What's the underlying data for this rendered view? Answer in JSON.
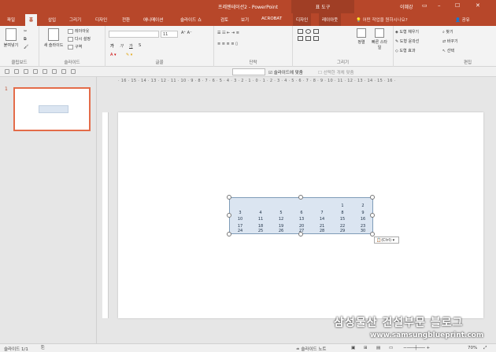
{
  "titlebar": {
    "title": "프레젠테이션2 - PowerPoint",
    "context": "표 도구",
    "user": "이혜강"
  },
  "tabs": [
    "파일",
    "홈",
    "삽입",
    "그리기",
    "디자인",
    "전환",
    "애니메이션",
    "슬라이드 쇼",
    "검토",
    "보기",
    "ACROBAT",
    "디자인",
    "레이아웃"
  ],
  "tellme": "어떤 작업을 원하시나요?",
  "share": "공유",
  "ribbon": {
    "clipboard": {
      "label": "클립보드",
      "paste": "붙여넣기"
    },
    "slides": {
      "label": "슬라이드",
      "new": "새 슬라이드",
      "layout": "레이아웃",
      "reset": "다시 설정",
      "section": "구역"
    },
    "font": {
      "label": "글꼴",
      "size": "11",
      "bold": "가",
      "italic": "가",
      "underline": "가",
      "strike": "S"
    },
    "paragraph": {
      "label": "단락"
    },
    "drawing": {
      "label": "그리기",
      "arrange": "정렬",
      "styles": "빠른 스타일",
      "fill": "도형 채우기",
      "outline": "도형 윤곽선",
      "effects": "도형 효과"
    },
    "editing": {
      "label": "편집",
      "find": "찾기",
      "replace": "바꾸기",
      "select": "선택"
    }
  },
  "qat": {
    "fit": "슬라이드에 맞춤",
    "selected": "선택한 개체 맞춤"
  },
  "ruler": "· 16 · 15 · 14 · 13 · 12 · 11 · 10 · 9 · 8 · 7 · 6 · 5 · 4 · 3 · 2 · 1 · 0 · 1 · 2 · 3 · 4 · 5 · 6 · 7 · 8 · 9 · 10 · 11 · 12 · 13 · 14 · 15 · 16 ·",
  "slide_number": "1",
  "table": {
    "rows": [
      [
        "",
        "",
        "",
        "",
        "",
        "1",
        "2"
      ],
      [
        "3",
        "4",
        "5",
        "6",
        "7",
        "8",
        "9"
      ],
      [
        "10",
        "11",
        "12",
        "13",
        "14",
        "15",
        "16"
      ],
      [
        "17",
        "18",
        "19",
        "20",
        "21",
        "22",
        "23"
      ],
      [
        "24",
        "25",
        "26",
        "27",
        "28",
        "29",
        "30"
      ]
    ]
  },
  "paste_options": "(Ctrl) ▾",
  "status": {
    "slide": "슬라이드 1/1",
    "notes": "슬라이드 노트",
    "zoom": "70%"
  },
  "watermark": {
    "main": "삼성물산 건설부문 블로그",
    "url": "www.samsungblueprint.com"
  }
}
